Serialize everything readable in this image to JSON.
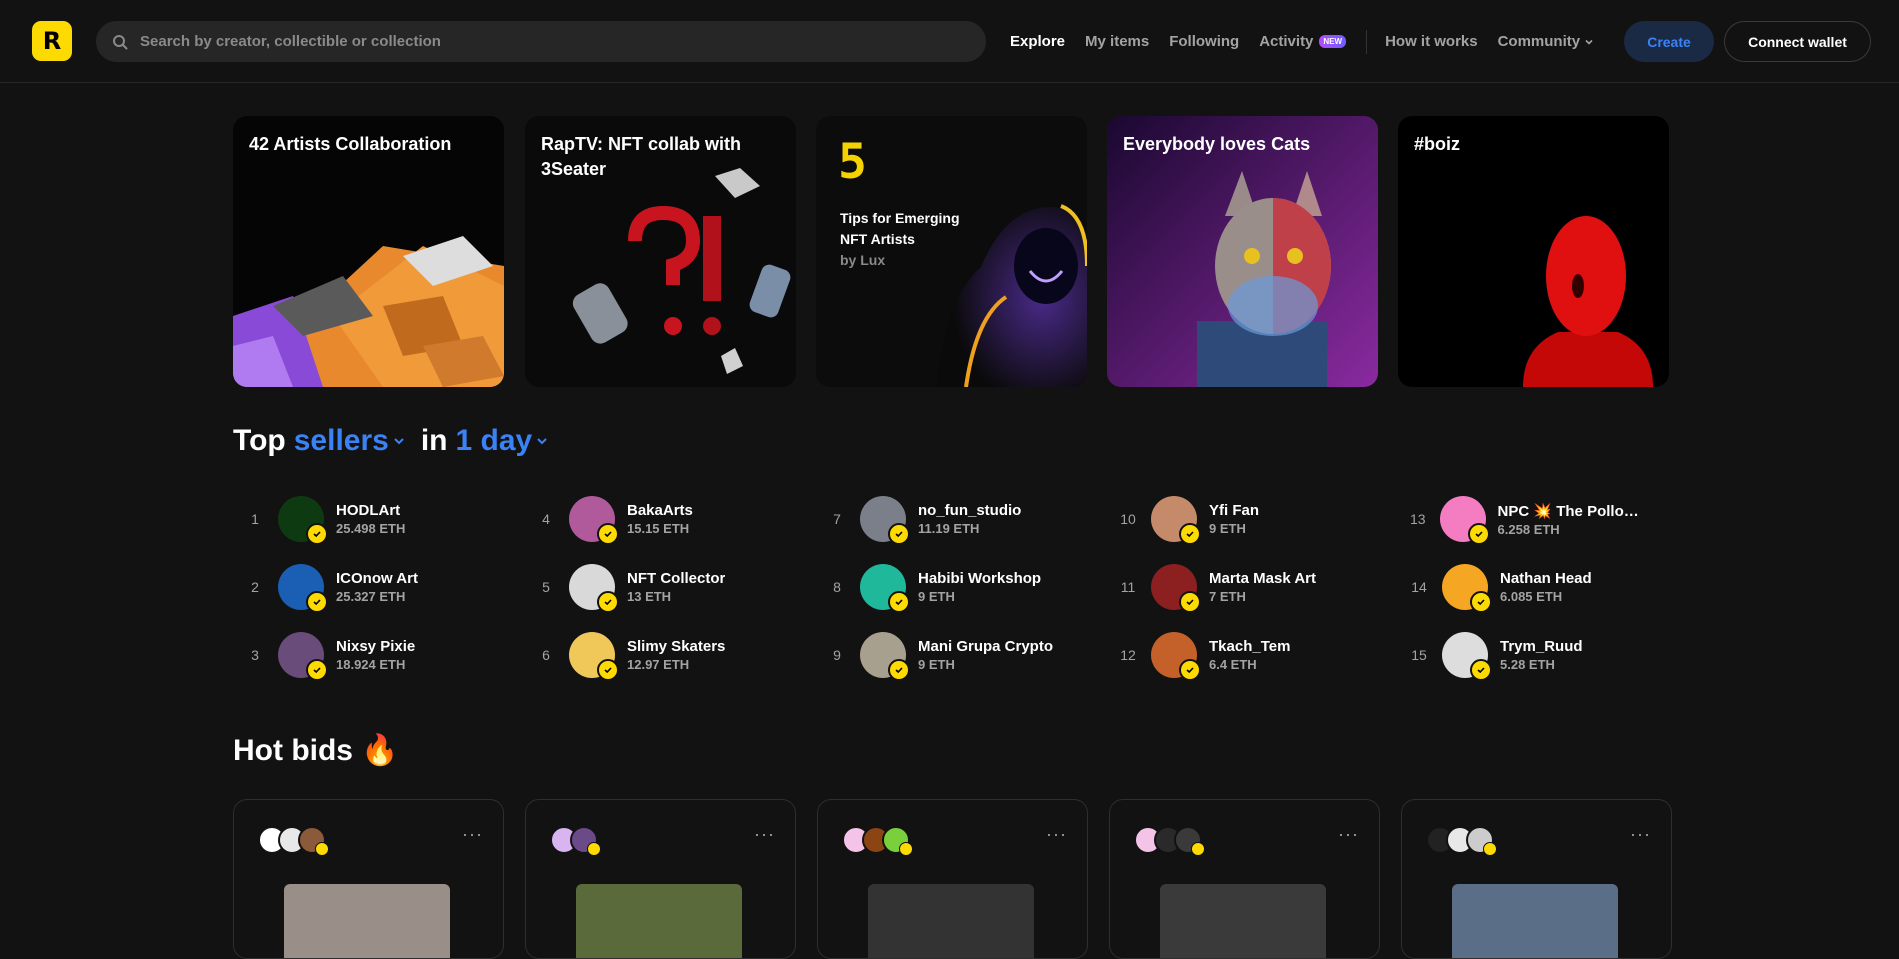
{
  "header": {
    "logo_letter": "R",
    "search_placeholder": "Search by creator, collectible or collection",
    "nav": [
      {
        "label": "Explore",
        "active": true
      },
      {
        "label": "My items"
      },
      {
        "label": "Following"
      },
      {
        "label": "Activity",
        "badge": "NEW"
      },
      {
        "label": "How it works"
      },
      {
        "label": "Community"
      }
    ],
    "create_label": "Create",
    "wallet_label": "Connect wallet"
  },
  "featured": [
    {
      "title": "42 Artists Collaboration"
    },
    {
      "title": "RapTV: NFT collab with 3Seater"
    },
    {
      "title": "",
      "overlay": {
        "number": "5",
        "line1": "Tips for Emerging",
        "line2": "NFT Artists",
        "line3": "by Lux"
      }
    },
    {
      "title": "Everybody loves Cats"
    },
    {
      "title": "#boiz"
    }
  ],
  "top_sellers": {
    "title_prefix": "Top",
    "filter_type": "sellers",
    "title_mid": "in",
    "filter_period": "1 day",
    "sellers": [
      {
        "rank": "1",
        "name": "HODLArt",
        "amount": "25.498 ETH",
        "color": "#0e3a12"
      },
      {
        "rank": "2",
        "name": "ICOnow Art",
        "amount": "25.327 ETH",
        "color": "#1a5fb4"
      },
      {
        "rank": "3",
        "name": "Nixsy Pixie",
        "amount": "18.924 ETH",
        "color": "#6a4c7a"
      },
      {
        "rank": "4",
        "name": "BakaArts",
        "amount": "15.15 ETH",
        "color": "#b05a9c"
      },
      {
        "rank": "5",
        "name": "NFT Collector",
        "amount": "13 ETH",
        "color": "#d9d9d9"
      },
      {
        "rank": "6",
        "name": "Slimy Skaters",
        "amount": "12.97 ETH",
        "color": "#f0c85a"
      },
      {
        "rank": "7",
        "name": "no_fun_studio",
        "amount": "11.19 ETH",
        "color": "#7a7f8a"
      },
      {
        "rank": "8",
        "name": "Habibi Workshop",
        "amount": "9 ETH",
        "color": "#1fb89a"
      },
      {
        "rank": "9",
        "name": "Mani Grupa Crypto",
        "amount": "9 ETH",
        "color": "#a8a08e"
      },
      {
        "rank": "10",
        "name": "Yfi Fan",
        "amount": "9 ETH",
        "color": "#c48a6a"
      },
      {
        "rank": "11",
        "name": "Marta Mask Art",
        "amount": "7 ETH",
        "color": "#8c1f1f"
      },
      {
        "rank": "12",
        "name": "Tkach_Tem",
        "amount": "6.4 ETH",
        "color": "#c4602a"
      },
      {
        "rank": "13",
        "name": "NPC 💥 The Pollock ...",
        "amount": "6.258 ETH",
        "color": "#f47cc0"
      },
      {
        "rank": "14",
        "name": "Nathan Head",
        "amount": "6.085 ETH",
        "color": "#f5a623"
      },
      {
        "rank": "15",
        "name": "Trym_Ruud",
        "amount": "5.28 ETH",
        "color": "#dddddd"
      }
    ]
  },
  "hot_bids": {
    "title": "Hot bids 🔥",
    "more_label": "···",
    "cards": [
      {
        "colors": [
          "#ffffff",
          "#e8e8e8",
          "#8a5a3a"
        ],
        "image_color": "#9a8f88"
      },
      {
        "colors": [
          "#d8b4f0",
          "#6b4a8a"
        ],
        "image_color": "#5a6a3a"
      },
      {
        "colors": [
          "#f4c4e8",
          "#8b4513",
          "#7ad03a"
        ],
        "image_color": "#333333"
      },
      {
        "colors": [
          "#f4c4e8",
          "#2a2a2a",
          "#3a3a3a"
        ],
        "image_color": "#3a3a3a"
      },
      {
        "colors": [
          "#222222",
          "#e8e8e8",
          "#cccccc"
        ],
        "image_color": "#5a6e88"
      }
    ]
  }
}
